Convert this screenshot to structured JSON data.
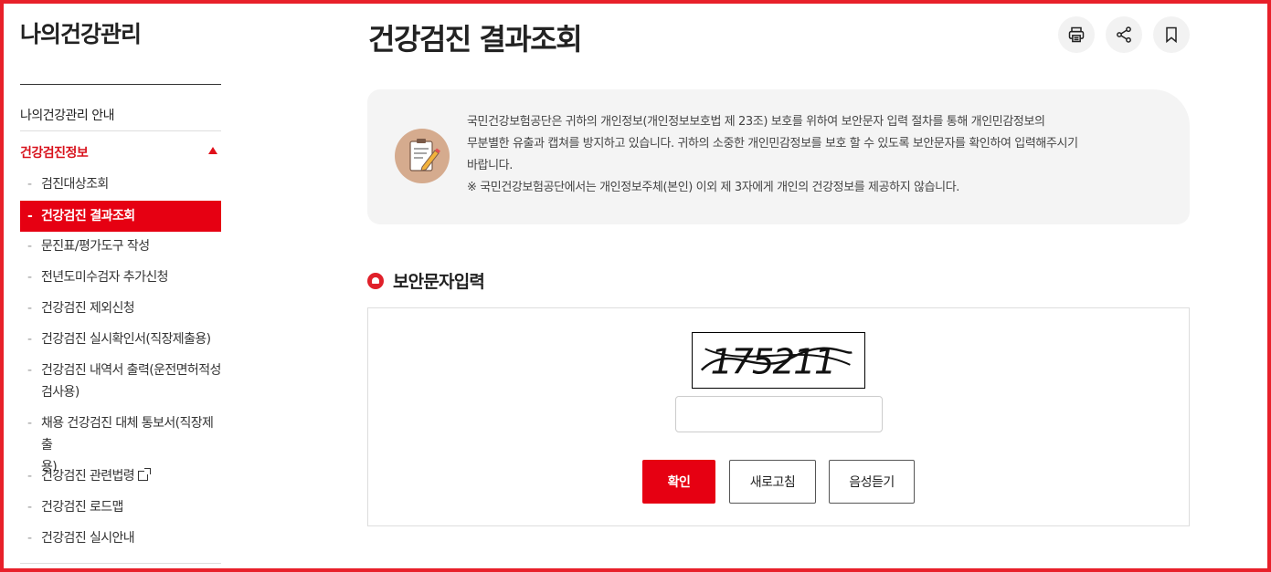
{
  "sidebar": {
    "title": "나의건강관리",
    "guide": "나의건강관리 안내",
    "section": "건강검진정보",
    "items": [
      {
        "label": "검진대상조회"
      },
      {
        "label": "건강검진 결과조회"
      },
      {
        "label": "문진표/평가도구 작성"
      },
      {
        "label": "전년도미수검자 추가신청"
      },
      {
        "label": "건강검진 제외신청"
      },
      {
        "label": "건강검진 실시확인서(직장제출용)"
      },
      {
        "label": "건강검진 내역서 출력(운전면허적성",
        "label2": "검사용)"
      },
      {
        "label": "채용 건강검진 대체 통보서(직장제출",
        "label2": "용)"
      },
      {
        "label": "건강검진 관련법령"
      },
      {
        "label": "건강검진 로드맵"
      },
      {
        "label": "건강검진 실시안내"
      }
    ]
  },
  "main": {
    "title": "건강검진 결과조회",
    "tools": [
      {
        "icon": "print-icon"
      },
      {
        "icon": "share-icon"
      },
      {
        "icon": "bookmark-icon"
      }
    ],
    "notice": {
      "icon": "clipboard-pencil-icon",
      "line1": "국민건강보험공단은 귀하의 개인정보(개인정보보호법 제 23조) 보호를 위하여 보안문자 입력 절차를 통해 개인민감정보의",
      "line2": "무분별한 유출과 캡쳐를 방지하고 있습니다. 귀하의 소중한 개인민감정보를 보호 할 수 있도록 보안문자를 확인하여 입력해주시기",
      "line3": "바랍니다.",
      "line4": "※ 국민건강보험공단에서는 개인정보주체(본인) 이외 제 3자에게 개인의 건강정보를 제공하지 않습니다."
    },
    "security": {
      "title": "보안문자입력",
      "captcha_text": "175211",
      "input_value": "",
      "confirm": "확인",
      "refresh": "새로고침",
      "audio": "음성듣기"
    }
  },
  "colors": {
    "accent": "#e60012",
    "frame": "#e8202a",
    "notice_bg": "#f4f4f4"
  }
}
